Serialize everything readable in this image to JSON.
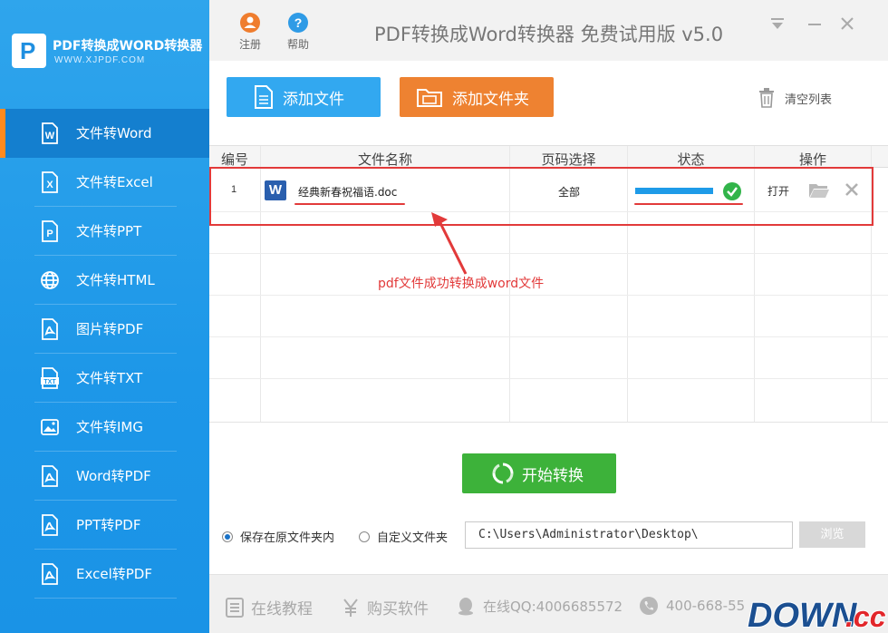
{
  "app": {
    "brand_title": "PDF转换成WORD转换器",
    "brand_url": "WWW.XJPDF.COM",
    "window_title": "PDF转换成Word转换器 免费试用版 v5.0"
  },
  "header": {
    "register_label": "注册",
    "help_label": "帮助"
  },
  "sidebar": {
    "items": [
      {
        "label": "文件转Word",
        "icon": "word-doc-icon"
      },
      {
        "label": "文件转Excel",
        "icon": "excel-doc-icon"
      },
      {
        "label": "文件转PPT",
        "icon": "ppt-doc-icon"
      },
      {
        "label": "文件转HTML",
        "icon": "globe-icon"
      },
      {
        "label": "图片转PDF",
        "icon": "pdf-doc-icon"
      },
      {
        "label": "文件转TXT",
        "icon": "txt-doc-icon"
      },
      {
        "label": "文件转IMG",
        "icon": "image-icon"
      },
      {
        "label": "Word转PDF",
        "icon": "pdf-doc-icon"
      },
      {
        "label": "PPT转PDF",
        "icon": "pdf-doc-icon"
      },
      {
        "label": "Excel转PDF",
        "icon": "pdf-doc-icon"
      }
    ],
    "active_index": 0
  },
  "toolbar": {
    "add_file_label": "添加文件",
    "add_folder_label": "添加文件夹",
    "clear_list_label": "清空列表"
  },
  "table": {
    "columns": [
      "编号",
      "文件名称",
      "页码选择",
      "状态",
      "操作"
    ],
    "rows": [
      {
        "no": "1",
        "file_name": "经典新春祝福语.doc",
        "file_icon_letter": "W",
        "pages": "全部",
        "progress": 1.0,
        "status": "done",
        "open_label": "打开"
      }
    ]
  },
  "annotation": {
    "text": "pdf文件成功转换成word文件",
    "color": "#e23a3a"
  },
  "actions": {
    "start_label": "开始转换"
  },
  "save": {
    "option_original_label": "保存在原文件夹内",
    "option_custom_label": "自定义文件夹",
    "selected": "original",
    "path_value": "C:\\Users\\Administrator\\Desktop\\",
    "browse_label": "浏览"
  },
  "footer": {
    "tutorial_label": "在线教程",
    "buy_label": "购买软件",
    "qq_label": "在线QQ:4006685572",
    "phone_label": "400-668-55"
  },
  "watermark": {
    "text": "DOWN.cc"
  },
  "colors": {
    "sidebar": "#1d97e8",
    "accent_blue": "#32a8f0",
    "accent_orange": "#ee8231",
    "start_green": "#3db23a",
    "progress_blue": "#1e9be8",
    "success_green": "#32b44a"
  }
}
